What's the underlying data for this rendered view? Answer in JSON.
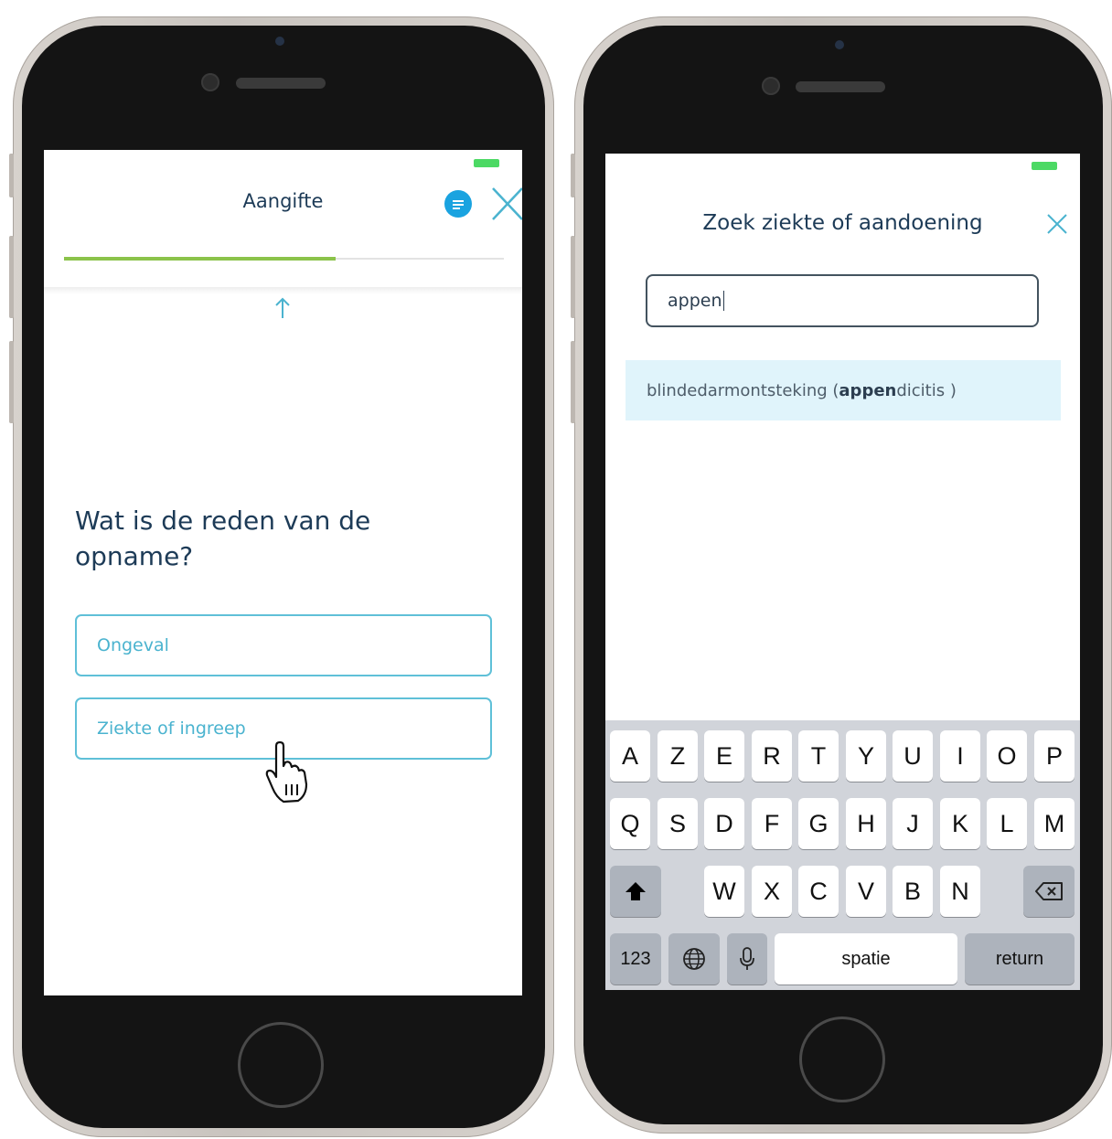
{
  "left_phone": {
    "header": {
      "title": "Aangifte",
      "progress_percent": 60
    },
    "question": "Wat is de reden van de opname?",
    "options": [
      {
        "label": "Ongeval"
      },
      {
        "label": "Ziekte of ingreep"
      }
    ]
  },
  "right_phone": {
    "header": {
      "title": "Zoek ziekte of aandoening"
    },
    "search": {
      "value": "appen"
    },
    "result": {
      "prefix": "blindedarmontsteking ( ",
      "match": "appen",
      "suffix": "dicitis )"
    },
    "keyboard": {
      "row1": [
        "A",
        "Z",
        "E",
        "R",
        "T",
        "Y",
        "U",
        "I",
        "O",
        "P"
      ],
      "row2": [
        "Q",
        "S",
        "D",
        "F",
        "G",
        "H",
        "J",
        "K",
        "L",
        "M"
      ],
      "row3": [
        "W",
        "X",
        "C",
        "V",
        "B",
        "N"
      ],
      "numbers_label": "123",
      "space_label": "spatie",
      "return_label": "return"
    }
  },
  "colors": {
    "accent": "#4ab3cf",
    "progress": "#8bc34a",
    "title": "#1d3b57"
  }
}
